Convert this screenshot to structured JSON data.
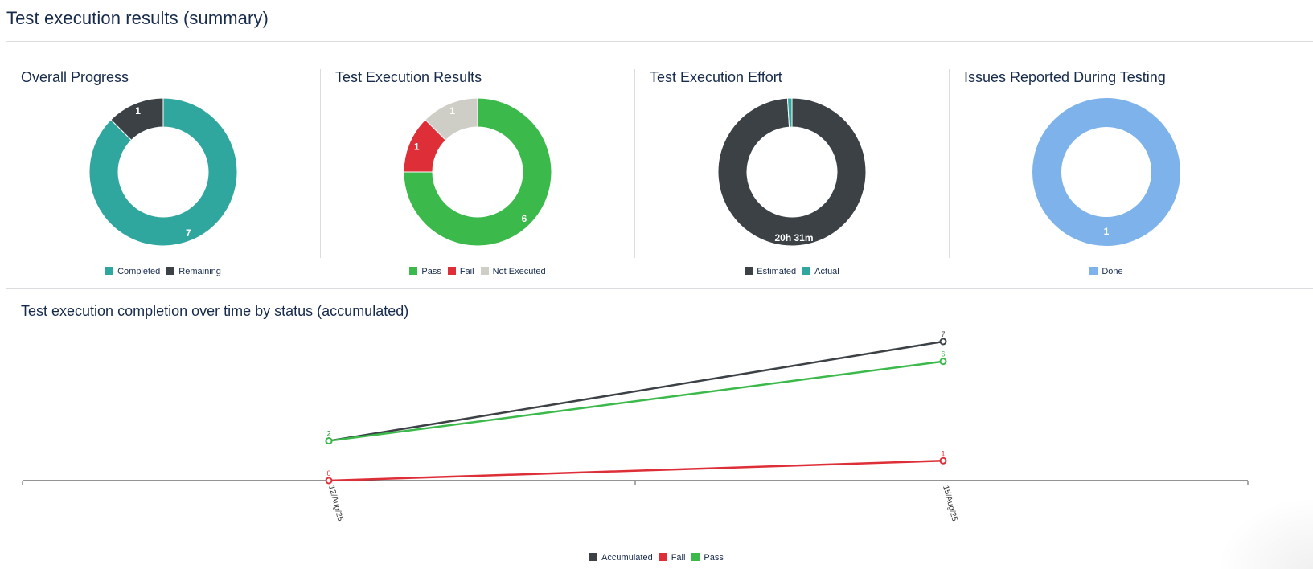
{
  "page": {
    "title": "Test execution results (summary)"
  },
  "panels": [
    {
      "title": "Overall Progress",
      "chart_data": {
        "type": "pie",
        "categories": [
          "Completed",
          "Remaining"
        ],
        "values": [
          7,
          1
        ],
        "colors": [
          "#2FA69E",
          "#3C4146"
        ],
        "labels": [
          "7",
          "1"
        ],
        "legend": [
          "Completed",
          "Remaining"
        ]
      }
    },
    {
      "title": "Test Execution Results",
      "chart_data": {
        "type": "pie",
        "categories": [
          "Pass",
          "Fail",
          "Not Executed"
        ],
        "values": [
          6,
          1,
          1
        ],
        "colors": [
          "#3CB94B",
          "#DE2E37",
          "#CFCEC6"
        ],
        "labels": [
          "6",
          "1",
          "1"
        ],
        "legend": [
          "Pass",
          "Fail",
          "Not Executed"
        ]
      }
    },
    {
      "title": "Test Execution Effort",
      "chart_data": {
        "type": "pie",
        "categories": [
          "Estimated",
          "Actual"
        ],
        "values": [
          20.52,
          0.2
        ],
        "colors": [
          "#3C4146",
          "#2FA69E"
        ],
        "labels": [
          "20h 31m",
          ""
        ],
        "legend": [
          "Estimated",
          "Actual"
        ]
      }
    },
    {
      "title": "Issues Reported During Testing",
      "chart_data": {
        "type": "pie",
        "categories": [
          "Done"
        ],
        "values": [
          1
        ],
        "colors": [
          "#7DB3EA"
        ],
        "labels": [
          "1"
        ],
        "legend": [
          "Done"
        ]
      }
    }
  ],
  "timeline": {
    "title": "Test execution completion over time by status (accumulated)",
    "chart_data": {
      "type": "line",
      "x": [
        "12/Aug/25",
        "15/Aug/25"
      ],
      "series": [
        {
          "name": "Accumulated",
          "color": "#3C4146",
          "values": [
            2,
            7
          ]
        },
        {
          "name": "Fail",
          "color": "#DE2E37",
          "values": [
            0,
            1
          ]
        },
        {
          "name": "Pass",
          "color": "#3CB94B",
          "values": [
            2,
            6
          ]
        }
      ],
      "ylim": [
        0,
        7
      ]
    }
  }
}
